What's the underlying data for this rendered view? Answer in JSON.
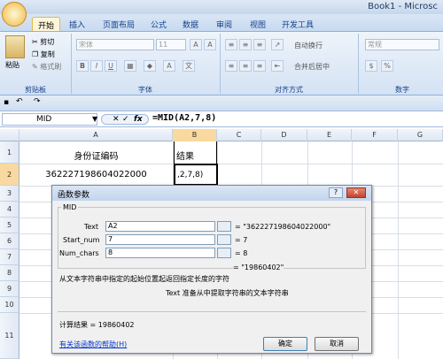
{
  "window": {
    "title": "Book1 - Microsc"
  },
  "tabs": [
    "开始",
    "插入",
    "页面布局",
    "公式",
    "数据",
    "审阅",
    "视图",
    "开发工具"
  ],
  "ribbon": {
    "paste": "粘贴",
    "cut": "剪切",
    "copy": "复制",
    "format_painter": "格式刷",
    "clipboard_group": "剪贴板",
    "font_name": "宋体",
    "font_size": "11",
    "font_group": "字体",
    "wrap_text": "自动换行",
    "merge_center": "合并后居中",
    "align_group": "对齐方式",
    "number_format": "常规",
    "number_group": "数字",
    "bold": "B",
    "italic": "I",
    "underline": "U"
  },
  "formula_bar": {
    "name_box": "MID",
    "formula": "=MID(A2,7,8)",
    "fx": "fx"
  },
  "columns": [
    "A",
    "B",
    "C",
    "D",
    "E",
    "F",
    "G"
  ],
  "rows": [
    "1",
    "2",
    "3",
    "4",
    "5",
    "6",
    "7",
    "8",
    "9",
    "10",
    "11"
  ],
  "cells": {
    "A1": "身份证编码",
    "B1": "结果",
    "A2": "362227198604022000",
    "B2": ",2,7,8)"
  },
  "dialog": {
    "title": "函数参数",
    "func": "MID",
    "args": [
      {
        "label": "Text",
        "value": "A2",
        "result": "= \"362227198604022000\""
      },
      {
        "label": "Start_num",
        "value": "7",
        "result": "= 7"
      },
      {
        "label": "Num_chars",
        "value": "8",
        "result": "= 8"
      }
    ],
    "overall_result": "= \"19860402\"",
    "description": "从文本字符串中指定的起始位置起返回指定长度的字符",
    "arg_help": "Text  准备从中提取字符串的文本字符串",
    "calc_result": "计算结果 =  19860402",
    "help_link": "有关该函数的帮助(H)",
    "ok": "确定",
    "cancel": "取消"
  }
}
